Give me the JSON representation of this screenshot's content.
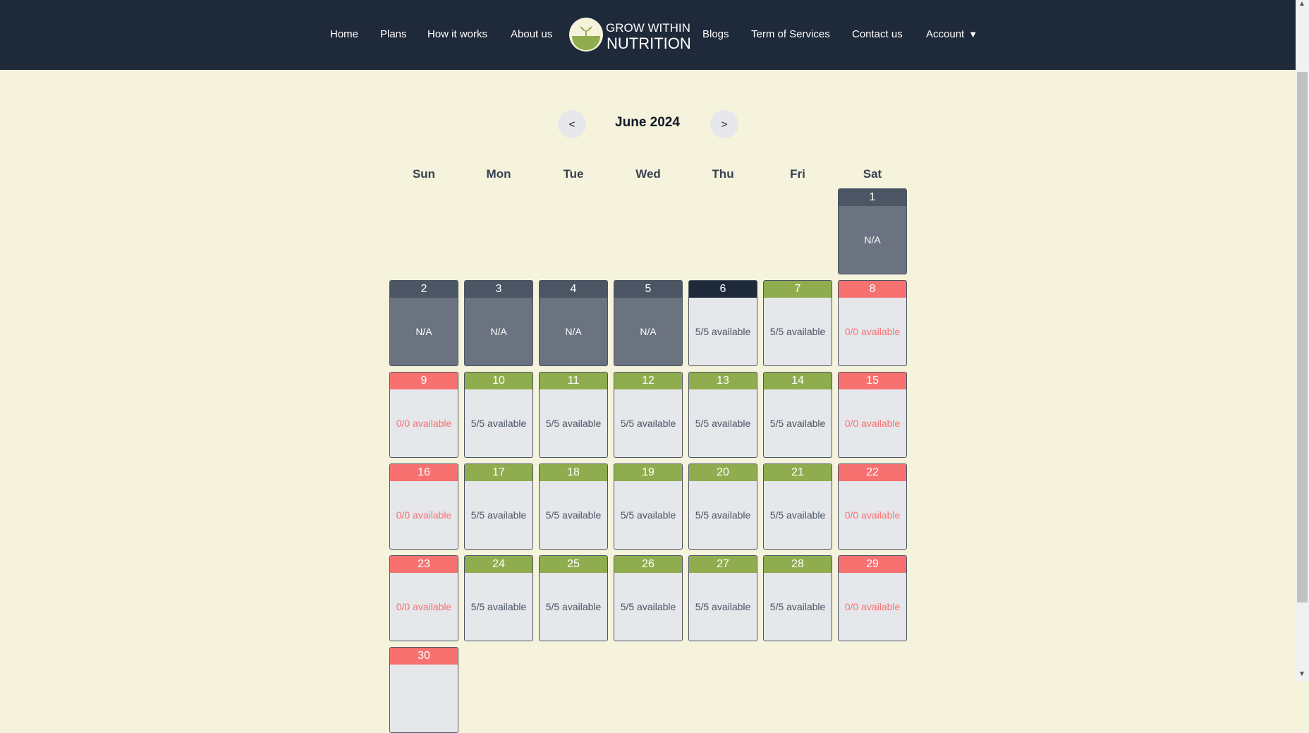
{
  "nav": {
    "links_left": [
      "Home",
      "Plans",
      "How it works",
      "About us"
    ],
    "brand_line1": "GROW WITHIN",
    "brand_line2": "NUTRITION",
    "links_right": [
      "Blogs",
      "Term of Services",
      "Contact us"
    ],
    "account_label": "Account",
    "account_arrow": "▼"
  },
  "calendar": {
    "prev_label": "<",
    "next_label": ">",
    "month_title": "June 2024",
    "weekdays": [
      "Sun",
      "Mon",
      "Tue",
      "Wed",
      "Thu",
      "Fri",
      "Sat"
    ],
    "days": [
      {
        "day": "1",
        "text": "N/A",
        "status": "na"
      },
      {
        "day": "2",
        "text": "N/A",
        "status": "na"
      },
      {
        "day": "3",
        "text": "N/A",
        "status": "na"
      },
      {
        "day": "4",
        "text": "N/A",
        "status": "na"
      },
      {
        "day": "5",
        "text": "N/A",
        "status": "na"
      },
      {
        "day": "6",
        "text": "5/5 available",
        "status": "today"
      },
      {
        "day": "7",
        "text": "5/5 available",
        "status": "open"
      },
      {
        "day": "8",
        "text": "0/0 available",
        "status": "full"
      },
      {
        "day": "9",
        "text": "0/0 available",
        "status": "full"
      },
      {
        "day": "10",
        "text": "5/5 available",
        "status": "open"
      },
      {
        "day": "11",
        "text": "5/5 available",
        "status": "open"
      },
      {
        "day": "12",
        "text": "5/5 available",
        "status": "open"
      },
      {
        "day": "13",
        "text": "5/5 available",
        "status": "open"
      },
      {
        "day": "14",
        "text": "5/5 available",
        "status": "open"
      },
      {
        "day": "15",
        "text": "0/0 available",
        "status": "full"
      },
      {
        "day": "16",
        "text": "0/0 available",
        "status": "full"
      },
      {
        "day": "17",
        "text": "5/5 available",
        "status": "open"
      },
      {
        "day": "18",
        "text": "5/5 available",
        "status": "open"
      },
      {
        "day": "19",
        "text": "5/5 available",
        "status": "open"
      },
      {
        "day": "20",
        "text": "5/5 available",
        "status": "open"
      },
      {
        "day": "21",
        "text": "5/5 available",
        "status": "open"
      },
      {
        "day": "22",
        "text": "0/0 available",
        "status": "full"
      },
      {
        "day": "23",
        "text": "0/0 available",
        "status": "full"
      },
      {
        "day": "24",
        "text": "5/5 available",
        "status": "open"
      },
      {
        "day": "25",
        "text": "5/5 available",
        "status": "open"
      },
      {
        "day": "26",
        "text": "5/5 available",
        "status": "open"
      },
      {
        "day": "27",
        "text": "5/5 available",
        "status": "open"
      },
      {
        "day": "28",
        "text": "5/5 available",
        "status": "open"
      },
      {
        "day": "29",
        "text": "0/0 available",
        "status": "full"
      },
      {
        "day": "30",
        "text": "",
        "status": "full"
      }
    ]
  },
  "colors": {
    "header_bg": "#1e2939",
    "page_bg": "#f5f3dc",
    "available": "#8fad4e",
    "full": "#f87171",
    "na": "#6b7280"
  }
}
